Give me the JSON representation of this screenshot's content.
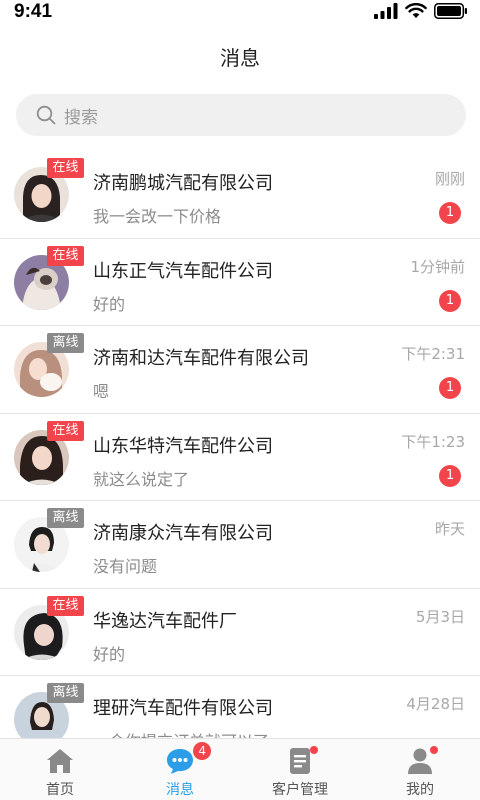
{
  "status_bar": {
    "time": "9:41"
  },
  "header": {
    "title": "消息"
  },
  "search": {
    "placeholder": "搜索"
  },
  "conversations": [
    {
      "status": "在线",
      "online": true,
      "name": "济南鹏城汽配有限公司",
      "message": "我一会改一下价格",
      "time": "刚刚",
      "unread": "1"
    },
    {
      "status": "在线",
      "online": true,
      "name": "山东正气汽车配件公司",
      "message": "好的",
      "time": "1分钟前",
      "unread": "1"
    },
    {
      "status": "离线",
      "online": false,
      "name": "济南和达汽车配件有限公司",
      "message": "嗯",
      "time": "下午2:31",
      "unread": "1"
    },
    {
      "status": "在线",
      "online": true,
      "name": "山东华特汽车配件公司",
      "message": "就这么说定了",
      "time": "下午1:23",
      "unread": "1"
    },
    {
      "status": "离线",
      "online": false,
      "name": "济南康众汽车有限公司",
      "message": "没有问题",
      "time": "昨天",
      "unread": ""
    },
    {
      "status": "在线",
      "online": true,
      "name": "华逸达汽车配件厂",
      "message": "好的",
      "time": "5月3日",
      "unread": ""
    },
    {
      "status": "离线",
      "online": false,
      "name": "理研汽车配件有限公司",
      "message": "一会你提交订单就可以了",
      "time": "4月28日",
      "unread": ""
    }
  ],
  "tabs": [
    {
      "label": "首页",
      "icon": "home-icon",
      "active": false
    },
    {
      "label": "消息",
      "icon": "message-icon",
      "active": true,
      "count": "4"
    },
    {
      "label": "客户管理",
      "icon": "customer-management-icon",
      "active": false,
      "dot": true
    },
    {
      "label": "我的",
      "icon": "profile-icon",
      "active": false,
      "dot": true
    }
  ],
  "colors": {
    "accent": "#2c9ee8",
    "badge_red": "#f2444b",
    "offline_gray": "#8a8a8a"
  }
}
